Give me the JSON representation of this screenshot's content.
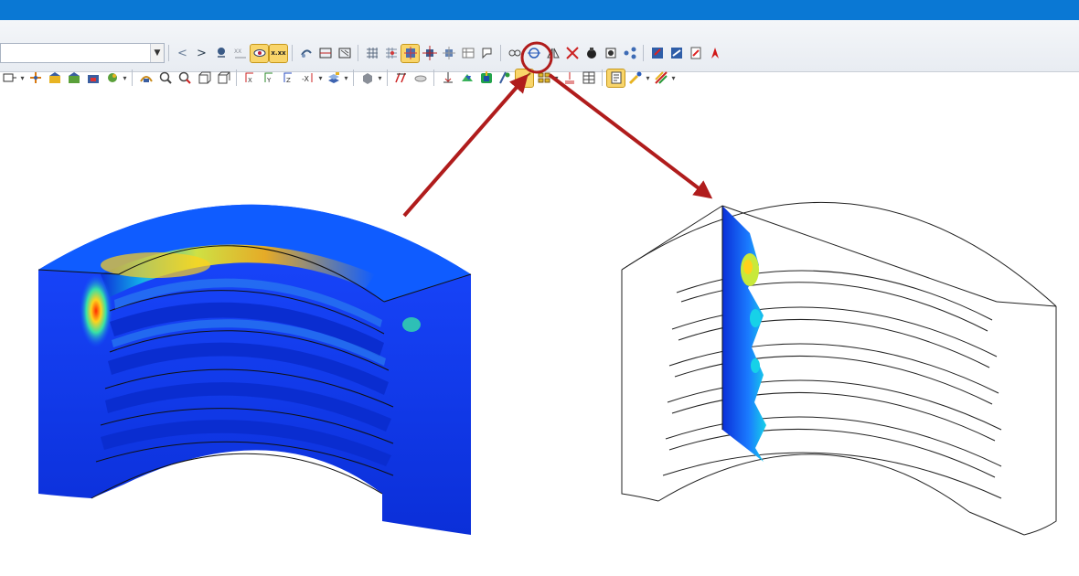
{
  "window": {
    "title_bar_color": "#0a78d4"
  },
  "toolbar": {
    "row1": {
      "combo_value": "",
      "active_button_label": "x.xx",
      "icons": [
        "nav-back-icon",
        "nav-forward-icon",
        "pin-icon",
        "scale-icon",
        "view-eye-icon",
        "value-display-icon",
        "rotate-icon",
        "section-plane-icon",
        "section-fill-icon",
        "mesh-grid-icon",
        "grid-points-icon",
        "fit-view-icon",
        "node-move-icon",
        "node-copy-icon",
        "table-icon",
        "probe-icon",
        "chain-icon",
        "circle-cut-icon",
        "mirror-icon",
        "cross-icon",
        "object-icon",
        "stamp-icon",
        "share-icon",
        "export-icon",
        "export-active-icon",
        "pdf-icon",
        "acrobat-icon"
      ]
    },
    "row2": {
      "highlighted_icon": "clipping-box-icon",
      "icons": [
        "select-icon",
        "filter-icon",
        "model-a-icon",
        "model-b-icon",
        "model-c-icon",
        "render-icon",
        "deform-icon",
        "zoom-window-icon",
        "zoom-icon",
        "box-icon",
        "iso-view-icon",
        "rot-x-icon",
        "rot-y-icon",
        "rot-z-icon",
        "rot-neg-x-icon",
        "layer-icon",
        "color-icon",
        "curve-icon",
        "eraser-icon",
        "dimension-icon",
        "clipping-plane-icon",
        "clipping-box-icon",
        "clip-options-icon",
        "plane-yellow-icon",
        "split-icon",
        "align-icon",
        "panel-icon",
        "report-icon",
        "brush-icon",
        "color-scale-icon"
      ]
    }
  },
  "annotation": {
    "highlight_color": "#b01c1c",
    "arrow_color": "#b01c1c"
  },
  "views": {
    "left": {
      "name": "full stress contour",
      "colors": [
        "#0b2fd8",
        "#0f5cff",
        "#12b6e8",
        "#35e0a8",
        "#d8e93a",
        "#f0b01c",
        "#ff2a00"
      ]
    },
    "right": {
      "name": "clipped section",
      "colors": [
        "#0b2fd8",
        "#1a7cff",
        "#17d1e8",
        "#c8e93a",
        "#ffd21c"
      ]
    }
  }
}
